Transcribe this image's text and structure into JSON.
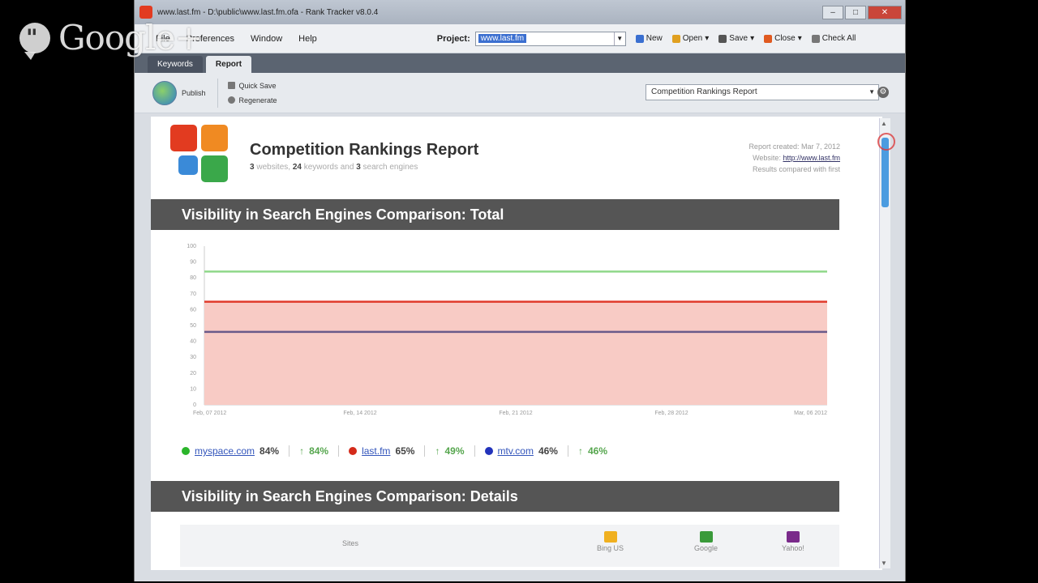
{
  "overlay": {
    "brand": "Google+"
  },
  "window": {
    "title": "www.last.fm - D:\\public\\www.last.fm.ofa - Rank Tracker v8.0.4",
    "controls": [
      "–",
      "□",
      "✕"
    ]
  },
  "menu": {
    "items": [
      "File",
      "Preferences",
      "Window",
      "Help"
    ],
    "project_label": "Project:",
    "project_value": "www.last.fm",
    "tools": [
      {
        "label": "New",
        "color": "#3a6fd0"
      },
      {
        "label": "Open",
        "color": "#e0a020"
      },
      {
        "label": "Save",
        "color": "#555555"
      },
      {
        "label": "Close",
        "color": "#e05a20"
      },
      {
        "label": "Check All",
        "color": "#777777"
      }
    ]
  },
  "tabs": [
    {
      "label": "Keywords",
      "active": false
    },
    {
      "label": "Report",
      "active": true
    }
  ],
  "toolbar": {
    "publish_label": "Publish",
    "quick_save_label": "Quick Save",
    "regenerate_label": "Regenerate",
    "report_select": "Competition Rankings Report",
    "gear": "⚙"
  },
  "report": {
    "logo_colors": [
      "#e23b20",
      "#f08a22",
      "#3a8ad8",
      "#3aa84a"
    ],
    "title": "Competition Rankings Report",
    "subtitle": {
      "websites_count": "3",
      "websites_label": "websites,",
      "keywords_count": "24",
      "keywords_label": "keywords and",
      "engines_count": "3",
      "engines_label": "search engines"
    },
    "meta": {
      "created": "Report created: Mar 7, 2012",
      "website_label": "Website:",
      "website_url": "http://www.last.fm",
      "compared": "Results compared with first"
    }
  },
  "sections": {
    "total": "Visibility in Search Engines Comparison: Total",
    "details": "Visibility in Search Engines Comparison: Details"
  },
  "chart_data": {
    "type": "area",
    "x_ticks": [
      "Feb, 07 2012",
      "Feb, 14 2012",
      "Feb, 21 2012",
      "Feb, 28 2012",
      "Mar, 06 2012"
    ],
    "y_ticks": [
      0,
      10,
      20,
      30,
      40,
      50,
      60,
      70,
      80,
      90,
      100
    ],
    "ylim": [
      0,
      100
    ],
    "series": [
      {
        "name": "myspace.com",
        "values": [
          84,
          84,
          84,
          84,
          84
        ],
        "color": "#8fd88a",
        "fill": false
      },
      {
        "name": "last.fm",
        "values": [
          65,
          65,
          65,
          65,
          65
        ],
        "color": "#e03a2a",
        "fill": true,
        "fill_color": "#f8cbc5"
      },
      {
        "name": "mtv.com",
        "values": [
          46,
          46,
          46,
          46,
          46
        ],
        "color": "#6a5a8a",
        "fill": false
      }
    ]
  },
  "legend": [
    {
      "site": "myspace.com",
      "value": "84%",
      "change": "84%",
      "color": "#2bb52b"
    },
    {
      "site": "last.fm",
      "value": "65%",
      "change": "49%",
      "color": "#d42a1a"
    },
    {
      "site": "mtv.com",
      "value": "46%",
      "change": "46%",
      "color": "#2233bb"
    }
  ],
  "details_table": {
    "first_col": "Sites",
    "engines": [
      {
        "label": "Bing US",
        "color": "#f0b020"
      },
      {
        "label": "Google",
        "color": "#3a9a3a"
      },
      {
        "label": "Yahoo!",
        "color": "#7a2a8a"
      }
    ]
  }
}
